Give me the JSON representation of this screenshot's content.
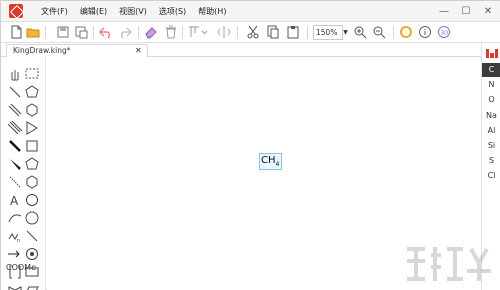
{
  "app": {
    "window_title": ""
  },
  "menu": {
    "file": "文件(F)",
    "edit": "编辑(E)",
    "view": "视图(V)",
    "options": "选项(S)",
    "help": "帮助(H)"
  },
  "window_controls": {
    "minimize": "—",
    "maximize": "☐",
    "close": "✕"
  },
  "toolbar": {
    "icons": [
      "new-icon",
      "open-icon",
      "save-icon",
      "save-as-icon",
      "undo-icon",
      "redo-icon",
      "eraser-icon",
      "delete-icon",
      "align-icon",
      "flip-icon",
      "cut-icon",
      "copy-icon",
      "paste-icon",
      "zoom-in-icon",
      "zoom-out-icon",
      "ring-icon",
      "info-icon",
      "3d-icon"
    ],
    "zoom_value": "150%",
    "zoom_arrow": "▼"
  },
  "tab": {
    "label": "KingDraw.king*",
    "close": "✕"
  },
  "left_tools": {
    "icons": [
      "hand-icon",
      "marquee-select-icon",
      "single-bond-icon",
      "pentagon-icon",
      "double-bond-icon",
      "hexagon-outline-icon",
      "triple-bond-icon",
      "triangle-icon",
      "bold-bond-icon",
      "square-icon",
      "wedge-bond-icon",
      "pentagon-ring-icon",
      "hash-bond-icon",
      "hexagon-ring-icon",
      "text-icon",
      "circle-icon",
      "curve-icon",
      "circle-outline-icon",
      "chain-icon",
      "line-icon",
      "arrow-icon",
      "target-icon",
      "bracket-icon",
      "rectangle-icon",
      "orbital-icon",
      "parallelogram-icon"
    ],
    "template_label": "COOMe"
  },
  "canvas": {
    "molecule_main": "CH",
    "molecule_sub": "4"
  },
  "elements": {
    "items": [
      "C",
      "N",
      "O",
      "Na",
      "Al",
      "Si",
      "S",
      "Cl"
    ],
    "selected": "C"
  },
  "colors": {
    "accent": "#d93a2b",
    "selection": "#8cc4e8",
    "selected_element_bg": "#3d3d3d"
  }
}
